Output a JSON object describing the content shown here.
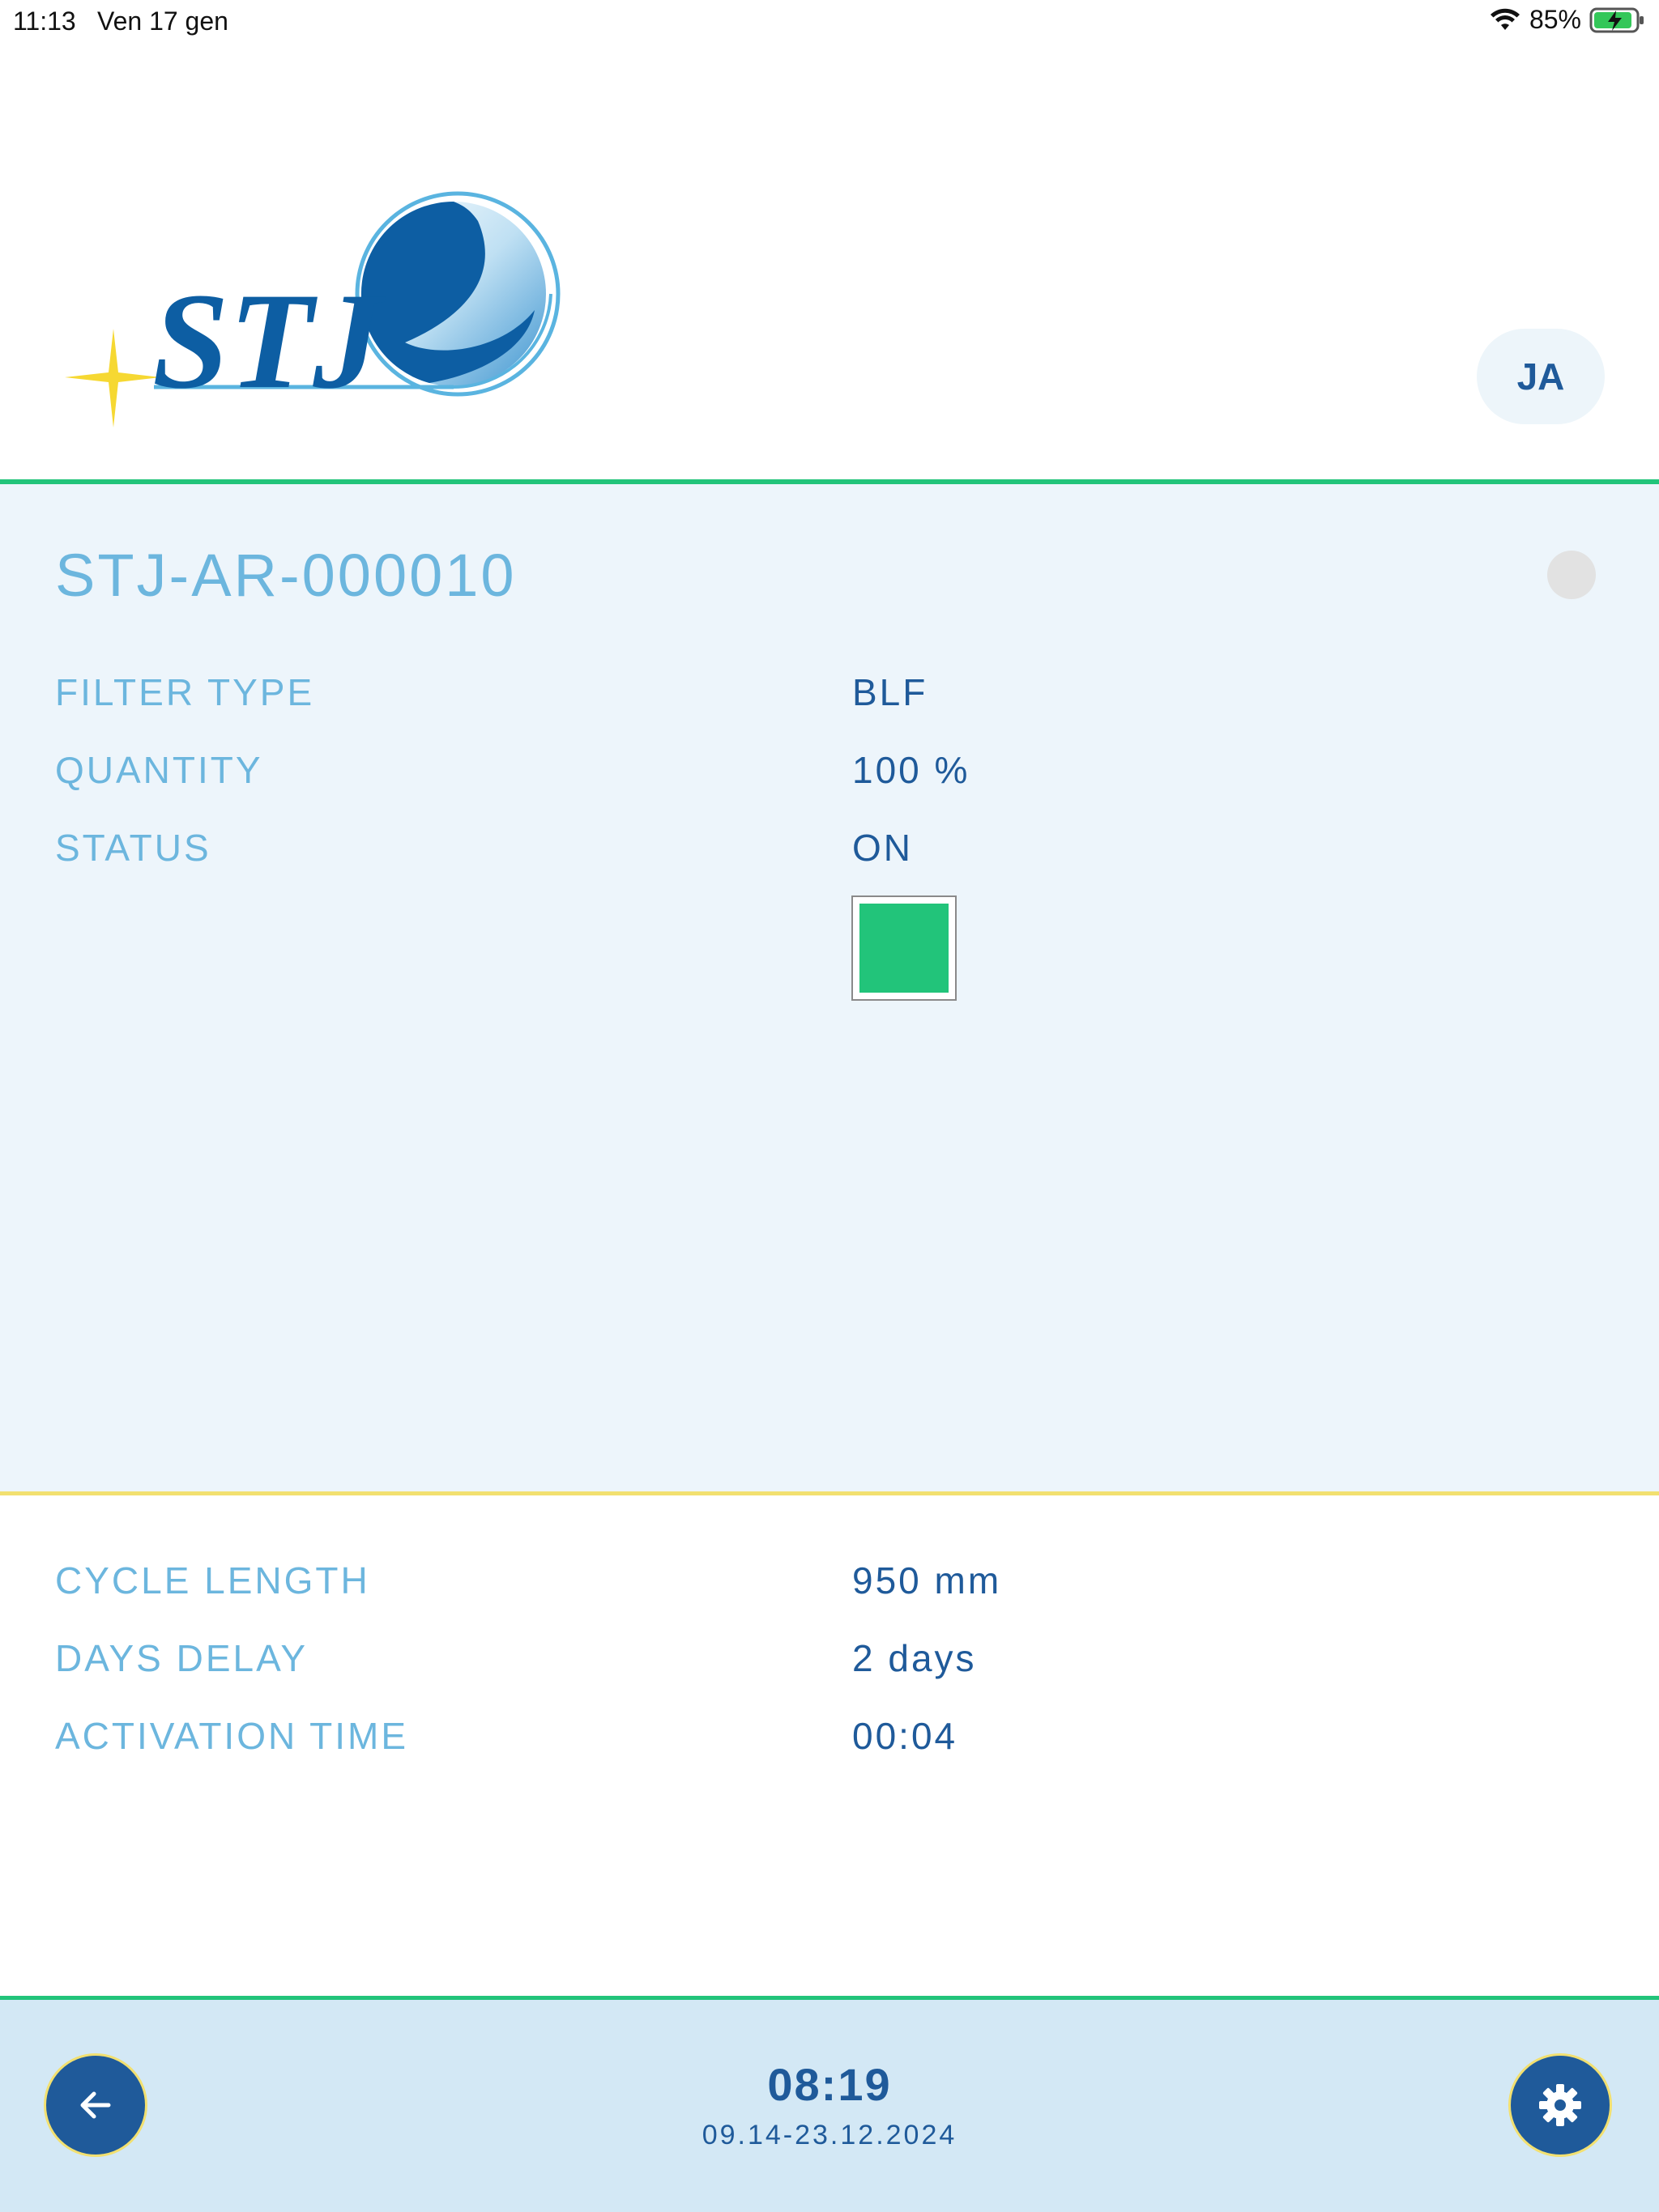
{
  "status_bar": {
    "time": "11:13",
    "date": "Ven 17 gen",
    "battery": "85%"
  },
  "header": {
    "logo_text": "STJ",
    "user_initials": "JA"
  },
  "device": {
    "id": "STJ-AR-000010",
    "rows": [
      {
        "label": "FILTER TYPE",
        "value": "BLF"
      },
      {
        "label": "QUANTITY",
        "value": "100 %"
      },
      {
        "label": "STATUS",
        "value": "ON"
      }
    ],
    "status_color": "#22c47a",
    "indicator_color": "#e2e2e2"
  },
  "settings": {
    "rows": [
      {
        "label": "CYCLE LENGTH",
        "value": "950 mm"
      },
      {
        "label": "DAYS DELAY",
        "value": "2 days"
      },
      {
        "label": "ACTIVATION TIME",
        "value": "00:04"
      }
    ]
  },
  "footer": {
    "clock": "08:19",
    "period": "09.14-23.12.2024",
    "back_icon": "arrow-left-icon",
    "settings_icon": "gear-icon"
  },
  "colors": {
    "primary": "#1f5a9a",
    "label": "#6cb6de",
    "accent_green": "#22c47a",
    "accent_yellow": "#f2e070",
    "panel_bg": "#edf5fb",
    "footer_bg": "#d3e8f5"
  }
}
